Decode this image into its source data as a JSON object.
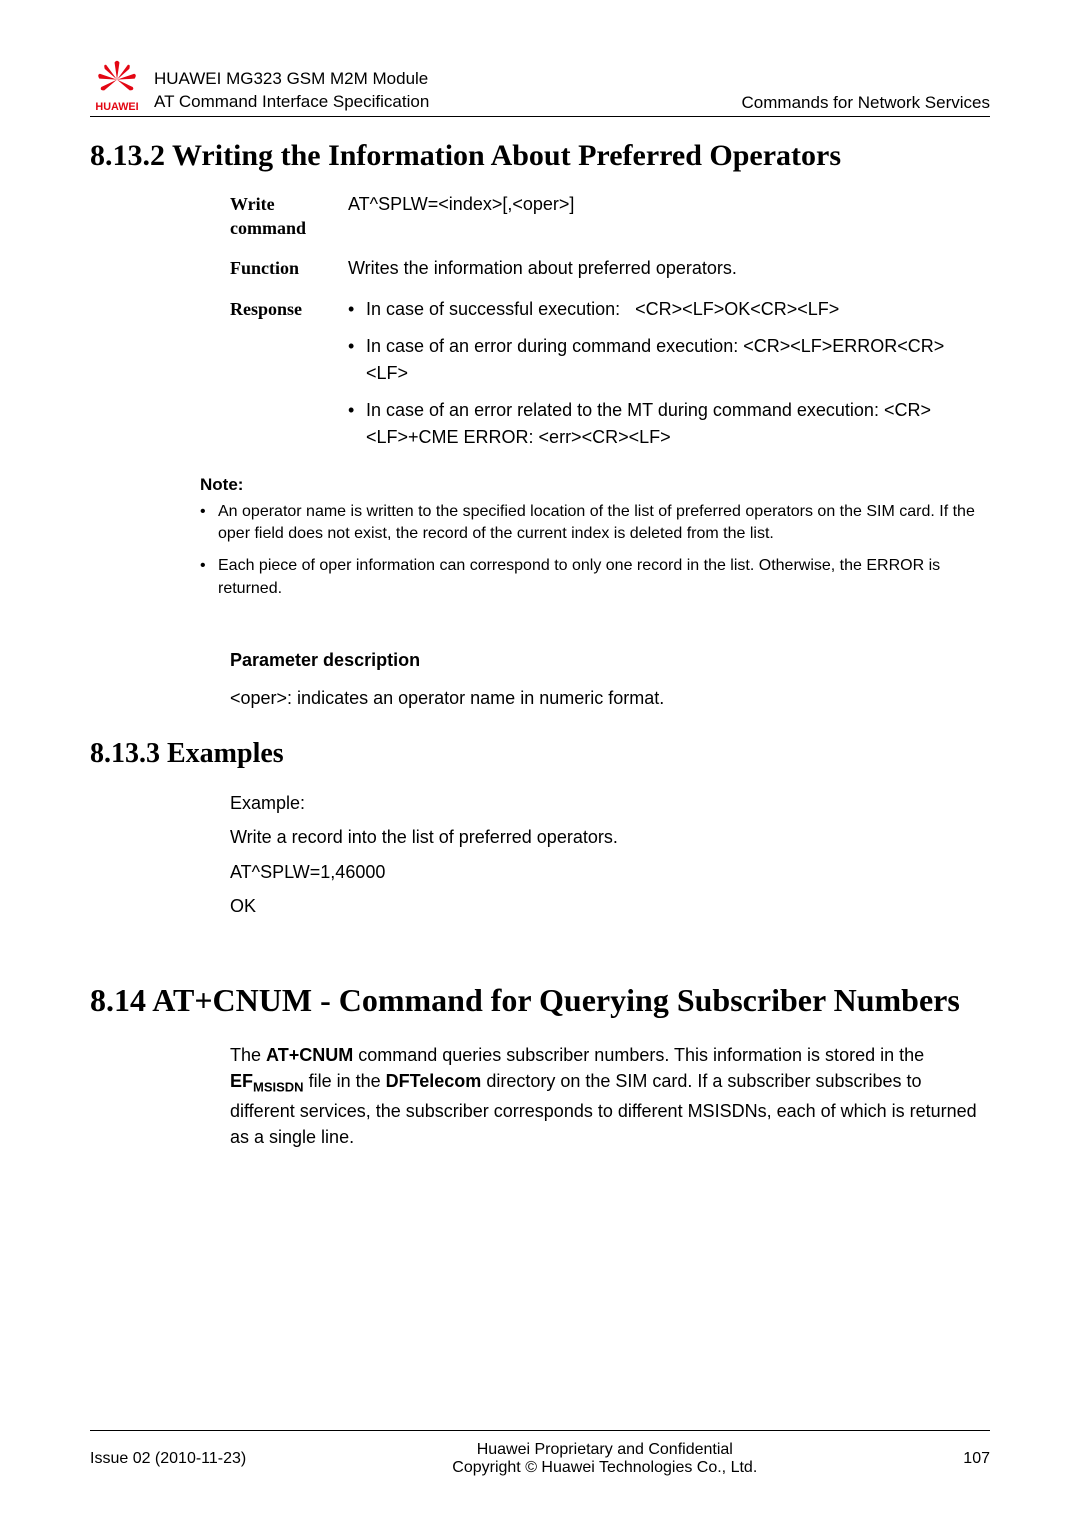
{
  "header": {
    "product": "HUAWEI MG323 GSM M2M Module",
    "doc": "AT Command Interface Specification",
    "right": "Commands for Network Services",
    "brand": "HUAWEI"
  },
  "section_8_13_2": {
    "title": "8.13.2 Writing the Information About Preferred Operators",
    "write_label": "Write command",
    "write_value": "AT^SPLW=<index>[,<oper>]",
    "function_label": "Function",
    "function_value": "Writes the information about preferred operators.",
    "response_label": "Response",
    "response_bullets": {
      "b1_prefix": "In case of successful execution:",
      "b1_suffix": "<CR><LF>OK<CR><LF>",
      "b2": "In case of an error during command execution: <CR><LF>ERROR<CR><LF>",
      "b3": "In case of an error related to the MT during command execution: <CR><LF>+CME ERROR: <err><CR><LF>"
    },
    "note_title": "Note:",
    "note_bullets": {
      "n1": "An operator name is written to the specified location of the list of preferred operators on the SIM card. If the oper field does not exist, the record of the current index is deleted from the list.",
      "n2": "Each piece of oper information can correspond to only one record in the list. Otherwise, the ERROR is returned."
    },
    "param_title": "Parameter description",
    "param_text": "<oper>: indicates an operator name in numeric format."
  },
  "section_8_13_3": {
    "title": "8.13.3 Examples",
    "example_label": "Example:",
    "example_desc": "Write a record into the list of preferred operators.",
    "cmd": "AT^SPLW=1,46000",
    "ok": "OK"
  },
  "section_8_14": {
    "title": "8.14 AT+CNUM - Command for Querying Subscriber Numbers",
    "para_parts": {
      "p1": "The ",
      "b1": "AT+CNUM",
      "p2": " command queries subscriber numbers. This information is stored in the ",
      "b2a": "EF",
      "b2b": "MSISDN",
      "p3": " file in the ",
      "b3": "DFTelecom",
      "p4": " directory on the SIM card. If a subscriber subscribes to different services, the subscriber corresponds to different MSISDNs, each of which is returned as a single line."
    }
  },
  "footer": {
    "left": "Issue 02 (2010-11-23)",
    "center1": "Huawei Proprietary and Confidential",
    "center2": "Copyright © Huawei Technologies Co., Ltd.",
    "right": "107"
  }
}
